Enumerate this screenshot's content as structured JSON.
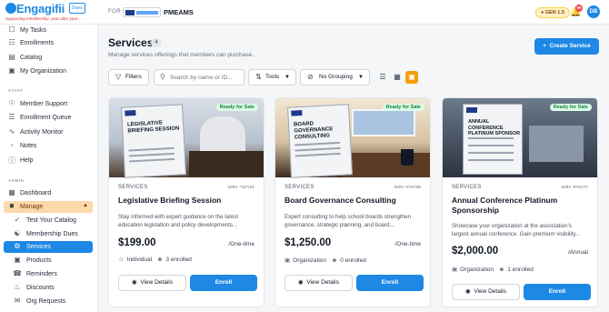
{
  "brand": {
    "logo_text": "Engagifii",
    "logo_sub": "Dues",
    "tagline": "Supporting membership, year after year..."
  },
  "header": {
    "for_label": "FOR",
    "org_name": "PMEAMS",
    "gen_badge": "GEN 1.5",
    "notifications_count": "99",
    "avatar_initials": "DB"
  },
  "sidebar": {
    "items_top": [
      {
        "label": "My Tasks",
        "icon": "tasks-icon"
      },
      {
        "label": "Enrollments",
        "icon": "enrollments-icon"
      },
      {
        "label": "Catalog",
        "icon": "catalog-icon"
      },
      {
        "label": "My Organization",
        "icon": "organization-icon"
      }
    ],
    "staff_label": "STAFF",
    "items_staff": [
      {
        "label": "Member Support",
        "icon": "support-icon"
      },
      {
        "label": "Enrollment Queue",
        "icon": "queue-icon"
      },
      {
        "label": "Activity Monitor",
        "icon": "activity-icon"
      },
      {
        "label": "Notes",
        "icon": "notes-icon"
      },
      {
        "label": "Help",
        "icon": "help-icon"
      }
    ],
    "admin_label": "ADMIN",
    "items_admin": [
      {
        "label": "Dashboard",
        "icon": "dashboard-icon"
      },
      {
        "label": "Manage",
        "icon": "manage-icon"
      },
      {
        "label": "Test Your Catalog",
        "icon": "test-catalog-icon"
      },
      {
        "label": "Membership Dues",
        "icon": "membership-dues-icon"
      },
      {
        "label": "Services",
        "icon": "services-icon"
      },
      {
        "label": "Products",
        "icon": "products-icon"
      },
      {
        "label": "Reminders",
        "icon": "reminders-icon"
      },
      {
        "label": "Discounts",
        "icon": "discounts-icon"
      },
      {
        "label": "Org Requests",
        "icon": "org-requests-icon"
      }
    ]
  },
  "page": {
    "title": "Services",
    "count": "4",
    "subtitle": "Manage services offerings that members can purchase.",
    "create_label": "Create Service"
  },
  "toolbar": {
    "filters_label": "Filters",
    "search_placeholder": "Search by name or ID...",
    "tools_label": "Tools",
    "grouping_label": "No Grouping"
  },
  "cards": [
    {
      "kind": "SERVICES",
      "code": "SERV-T6ZYGZ",
      "title": "Legislative Briefing Session",
      "description": "Stay informed with expert guidance on the latest education legislation and policy developments...",
      "price": "$199.00",
      "period": "/One-time",
      "audience": "Individual",
      "enrolled": "3 enrolled",
      "badge": "Ready for Sale",
      "sign_text": "LEGISLATIVE BRIEFING SESSION",
      "view_label": "View Details",
      "enroll_label": "Enroll"
    },
    {
      "kind": "SERVICES",
      "code": "SERV-SYNT5B",
      "title": "Board Governance Consulting",
      "description": "Expert consulting to help school boards strengthen governance, strategic planning, and board...",
      "price": "$1,250.00",
      "period": "/One-time",
      "audience": "Organization",
      "enrolled": "0 enrolled",
      "badge": "Ready for Sale",
      "sign_text": "BOARD GOVERNANCE CONSULTING",
      "view_label": "View Details",
      "enroll_label": "Enroll"
    },
    {
      "kind": "SERVICES",
      "code": "SERV-R7KCFY",
      "title": "Annual Conference Platinum Sponsorship",
      "description": "Showcase your organization at the association's largest annual conference. Gain premium visibility...",
      "price": "$2,000.00",
      "period": "/Annual",
      "audience": "Organization",
      "enrolled": "1 enrolled",
      "badge": "Ready for Sale",
      "sign_text": "ANNUAL CONFERENCE PLATINUM SPONSOR",
      "view_label": "View Details",
      "enroll_label": "Enroll"
    }
  ],
  "colors": {
    "primary": "#1e88e5",
    "manage_bg": "#fcd9a8",
    "ready_green": "#15803d",
    "accent_orange": "#f59e0b"
  }
}
